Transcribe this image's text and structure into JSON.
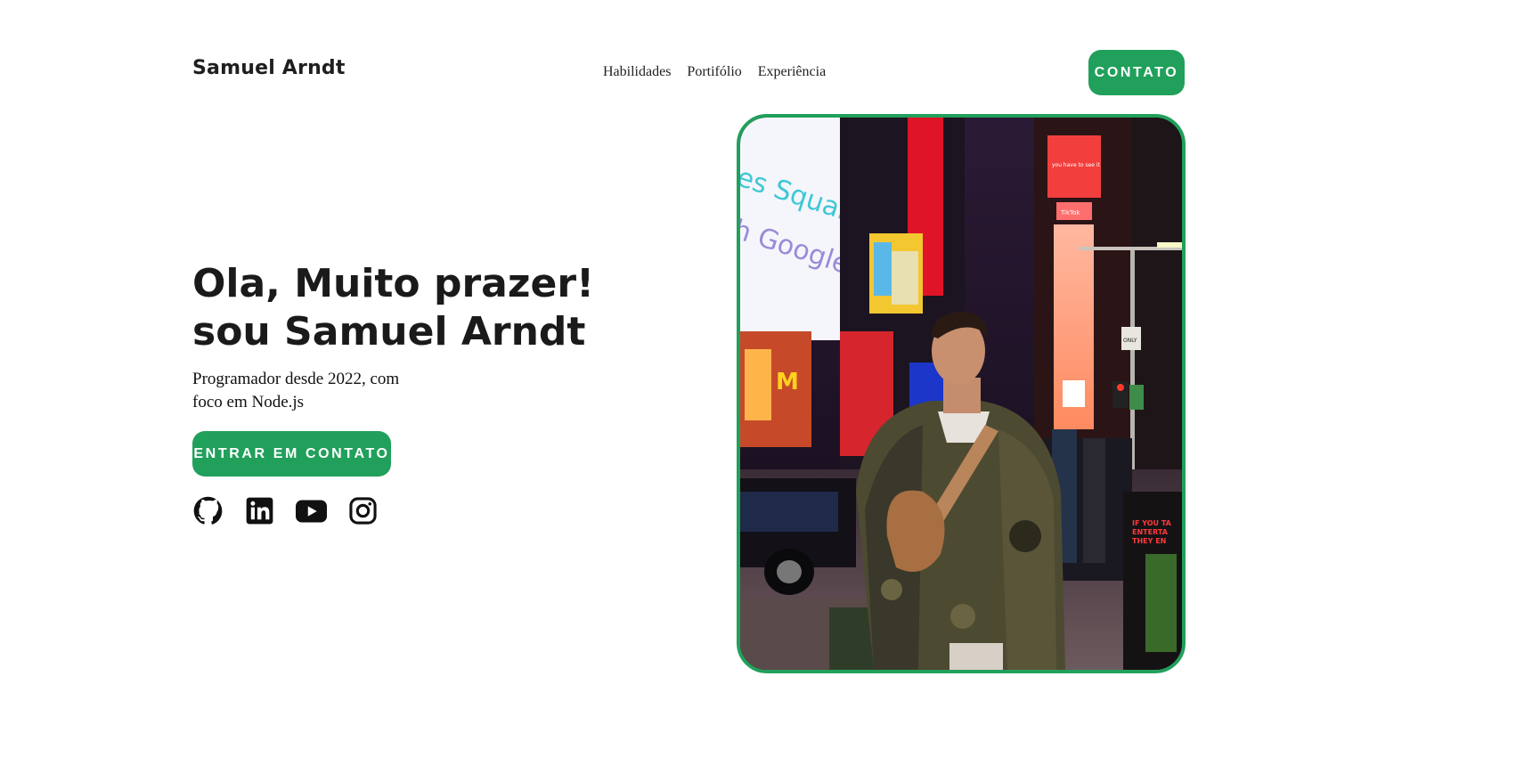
{
  "header": {
    "brand": "Samuel Arndt",
    "nav": [
      {
        "label": "Habilidades"
      },
      {
        "label": "Portifólio"
      },
      {
        "label": "Experiência"
      }
    ],
    "contact_button": "CONTATO"
  },
  "hero": {
    "title_line1": "Ola, Muito prazer!",
    "title_line2": "sou Samuel Arndt",
    "subtitle": "Programador desde 2022, com foco em Node.js",
    "cta_button": "ENTRAR EM CONTATO"
  },
  "socials": [
    {
      "icon": "github-icon"
    },
    {
      "icon": "linkedin-icon"
    },
    {
      "icon": "youtube-icon"
    },
    {
      "icon": "instagram-icon"
    }
  ],
  "photo": {
    "billboard_text": [
      "es Square",
      "h Google"
    ],
    "sign_text": [
      "you have to see it",
      "TikTok",
      "ONLY",
      "IF YOU TA",
      "ENTERTA",
      "THEY EN"
    ]
  },
  "colors": {
    "accent": "#21a05b",
    "text": "#1a1a1a",
    "background": "#ffffff"
  }
}
